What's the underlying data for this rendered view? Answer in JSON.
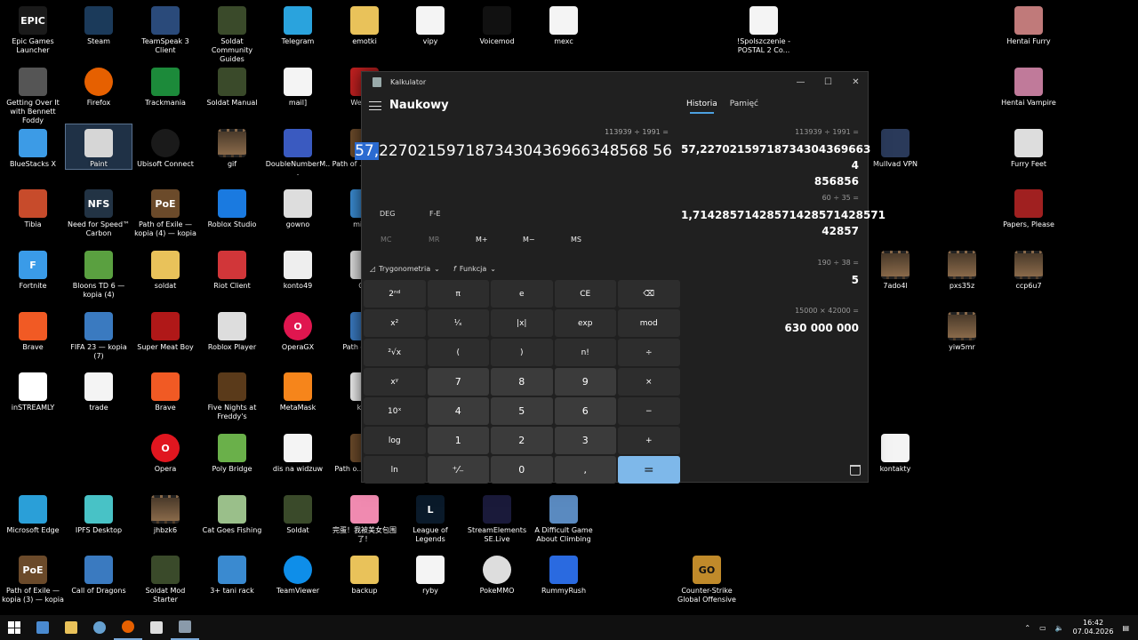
{
  "desktop_icons": [
    {
      "label": "Epic Games Launcher",
      "icon": "epic-games-icon",
      "color": "#1a1a1a",
      "text": "EPIC"
    },
    {
      "label": "Getting Over It with Bennett Foddy",
      "icon": "hammer-icon",
      "color": "#555555",
      "text": ""
    },
    {
      "label": "BlueStacks X",
      "icon": "bluestacks-icon",
      "color": "#3c9be6",
      "text": ""
    },
    {
      "label": "Tibia",
      "icon": "tibia-icon",
      "color": "#c74b2b",
      "text": ""
    },
    {
      "label": "Fortnite",
      "icon": "fortnite-icon",
      "color": "#3a9be8",
      "text": "F"
    },
    {
      "label": "Brave",
      "icon": "brave-icon",
      "color": "#f15a24",
      "text": ""
    },
    {
      "label": "inSTREAMLY",
      "icon": "instreamly-icon",
      "color": "#ffffff",
      "text": ""
    },
    {
      "label": "Microsoft Edge",
      "icon": "edge-icon",
      "color": "#2a9fd8",
      "text": ""
    },
    {
      "label": "Path of Exile — kopia (3) — kopia",
      "icon": "poe-icon",
      "color": "#6b4a2a",
      "text": "PoE"
    },
    {
      "label": "Steam",
      "icon": "steam-icon",
      "color": "#1b3a5a",
      "text": ""
    },
    {
      "label": "Firefox",
      "icon": "firefox-icon",
      "color": "#e66000",
      "text": ""
    },
    {
      "label": "Paint",
      "icon": "paint-icon",
      "color": "#d6d6d6",
      "text": ""
    },
    {
      "label": "Need for Speed™ Carbon",
      "icon": "nfs-icon",
      "color": "#223344",
      "text": "NFS"
    },
    {
      "label": "Bloons TD 6 — kopia (4)",
      "icon": "bloons-icon",
      "color": "#5aa040",
      "text": ""
    },
    {
      "label": "FIFA 23 — kopia (7)",
      "icon": "shortcut-icon",
      "color": "#3a7ac0",
      "text": ""
    },
    {
      "label": "trade",
      "icon": "file-icon",
      "color": "#f4f4f4",
      "text": ""
    },
    {
      "label": "",
      "icon": "",
      "color": "",
      "text": ""
    },
    {
      "label": "IPFS Desktop",
      "icon": "ipfs-icon",
      "color": "#48c2c6",
      "text": ""
    },
    {
      "label": "Call of Dragons",
      "icon": "shortcut-icon",
      "color": "#3a7ac0",
      "text": ""
    },
    {
      "label": "TeamSpeak 3 Client",
      "icon": "teamspeak-icon",
      "color": "#2a4a7a",
      "text": ""
    },
    {
      "label": "Trackmania",
      "icon": "trackmania-icon",
      "color": "#1c8a3a",
      "text": ""
    },
    {
      "label": "Ubisoft Connect",
      "icon": "ubisoft-icon",
      "color": "#1a1a1a",
      "text": ""
    },
    {
      "label": "Path of Exile — kopia (4) — kopia",
      "icon": "poe-icon",
      "color": "#6b4a2a",
      "text": "PoE"
    },
    {
      "label": "soldat",
      "icon": "folder-icon",
      "color": "#e9c25a",
      "text": ""
    },
    {
      "label": "Super Meat Boy",
      "icon": "meatboy-icon",
      "color": "#b01818",
      "text": ""
    },
    {
      "label": "Brave",
      "icon": "brave-icon",
      "color": "#f15a24",
      "text": ""
    },
    {
      "label": "Opera",
      "icon": "opera-icon",
      "color": "#e0161f",
      "text": "O"
    },
    {
      "label": "jhbzk6",
      "icon": "video-icon",
      "color": "#6a5a4a",
      "text": ""
    },
    {
      "label": "Soldat Mod Starter",
      "icon": "soldat-icon",
      "color": "#3a4a2a",
      "text": ""
    },
    {
      "label": "Soldat Community Guides",
      "icon": "soldat-icon",
      "color": "#3a4a2a",
      "text": ""
    },
    {
      "label": "Soldat Manual",
      "icon": "soldat-icon",
      "color": "#3a4a2a",
      "text": ""
    },
    {
      "label": "gif",
      "icon": "video-icon",
      "color": "#4a4a4a",
      "text": ""
    },
    {
      "label": "Roblox Studio",
      "icon": "roblox-studio-icon",
      "color": "#1a7ae0",
      "text": ""
    },
    {
      "label": "Riot Client",
      "icon": "riot-icon",
      "color": "#d13639",
      "text": ""
    },
    {
      "label": "Roblox Player",
      "icon": "roblox-icon",
      "color": "#dddddd",
      "text": ""
    },
    {
      "label": "Five Nights at Freddy's",
      "icon": "fnaf-icon",
      "color": "#5a3a1a",
      "text": ""
    },
    {
      "label": "Poly Bridge",
      "icon": "polybridge-icon",
      "color": "#6ab04a",
      "text": ""
    },
    {
      "label": "Cat Goes Fishing",
      "icon": "catfishing-icon",
      "color": "#9abf8a",
      "text": ""
    },
    {
      "label": "3+ tani rack",
      "icon": "keyboard-icon",
      "color": "#3a8ad0",
      "text": ""
    },
    {
      "label": "Telegram",
      "icon": "telegram-icon",
      "color": "#2aa3dd",
      "text": ""
    },
    {
      "label": "mail]",
      "icon": "file-icon",
      "color": "#f4f4f4",
      "text": ""
    },
    {
      "label": "DoubleNumberM...",
      "icon": "doublenumber-icon",
      "color": "#3a5ac0",
      "text": ""
    },
    {
      "label": "gowno",
      "icon": "gowno-icon",
      "color": "#dddddd",
      "text": ""
    },
    {
      "label": "konto49",
      "icon": "konto-icon",
      "color": "#eeeeee",
      "text": ""
    },
    {
      "label": "OperaGX",
      "icon": "operagx-icon",
      "color": "#e0164f",
      "text": "O"
    },
    {
      "label": "MetaMask",
      "icon": "metamask-icon",
      "color": "#f6851b",
      "text": ""
    },
    {
      "label": "dis na widzuw",
      "icon": "file-icon",
      "color": "#f4f4f4",
      "text": ""
    },
    {
      "label": "Soldat",
      "icon": "soldat-icon",
      "color": "#3a4a2a",
      "text": ""
    },
    {
      "label": "TeamViewer",
      "icon": "teamviewer-icon",
      "color": "#0e8ee9",
      "text": ""
    },
    {
      "label": "emotki",
      "icon": "folder-icon",
      "color": "#e9c25a",
      "text": ""
    },
    {
      "label": "Welco...",
      "icon": "welcome-icon",
      "color": "#c02020",
      "text": ""
    },
    {
      "label": "Path of ... kopia (5",
      "icon": "poe-icon",
      "color": "#6b4a2a",
      "text": ""
    },
    {
      "label": "mint...",
      "icon": "mint-icon",
      "color": "#3a8ad0",
      "text": ""
    },
    {
      "label": "O...",
      "icon": "o-icon",
      "color": "#dddddd",
      "text": ""
    },
    {
      "label": "Path o... kop",
      "icon": "shortcut-icon",
      "color": "#3a7ac0",
      "text": ""
    },
    {
      "label": "ko...",
      "icon": "konto-icon",
      "color": "#eeeeee",
      "text": ""
    },
    {
      "label": "Path o... kopia (6",
      "icon": "poe-icon",
      "color": "#6b4a2a",
      "text": ""
    },
    {
      "label": "完蛋！我被美女包围了！",
      "icon": "heart-game-icon",
      "color": "#f08ab0",
      "text": ""
    },
    {
      "label": "backup",
      "icon": "folder-icon",
      "color": "#e9c25a",
      "text": ""
    },
    {
      "label": "vipy",
      "icon": "file-icon",
      "color": "#f4f4f4",
      "text": ""
    },
    {
      "label": "League of Legends",
      "icon": "lol-icon",
      "color": "#0a1a2a",
      "text": "L"
    },
    {
      "label": "ryby",
      "icon": "file-icon",
      "color": "#f4f4f4",
      "text": ""
    },
    {
      "label": "Voicemod",
      "icon": "voicemod-icon",
      "color": "#111111",
      "text": ""
    },
    {
      "label": "StreamElements SE.Live",
      "icon": "streamelements-icon",
      "color": "#1a1a3a",
      "text": ""
    },
    {
      "label": "PokeMMO",
      "icon": "pokemmo-icon",
      "color": "#dddddd",
      "text": ""
    },
    {
      "label": "mexc",
      "icon": "file-icon",
      "color": "#f4f4f4",
      "text": ""
    },
    {
      "label": "A Difficult Game About Climbing",
      "icon": "climbing-icon",
      "color": "#5a8ac0",
      "text": ""
    },
    {
      "label": "RummyRush",
      "icon": "rummy-icon",
      "color": "#2a6ae0",
      "text": ""
    },
    {
      "label": "Counter-Strike Global Offensive",
      "icon": "csgo-icon",
      "color": "#c08a2a",
      "text": "GO"
    },
    {
      "label": "!Spolszczenie - POSTAL 2 Co...",
      "icon": "file-icon",
      "color": "#f4f4f4",
      "text": ""
    },
    {
      "label": "Mullvad VPN",
      "icon": "mullvad-icon",
      "color": "#2a3a5a",
      "text": ""
    },
    {
      "label": "kontakty",
      "icon": "file-icon",
      "color": "#f4f4f4",
      "text": ""
    },
    {
      "label": "7ado4l",
      "icon": "video-icon",
      "color": "#6a5a4a",
      "text": ""
    },
    {
      "label": "pxs35z",
      "icon": "video-icon",
      "color": "#6a5a4a",
      "text": ""
    },
    {
      "label": "yiw5mr",
      "icon": "video-icon",
      "color": "#6a5a4a",
      "text": ""
    },
    {
      "label": "ccp6u7",
      "icon": "video-icon",
      "color": "#6a5a4a",
      "text": ""
    },
    {
      "label": "Hentai Furry",
      "icon": "anime-icon",
      "color": "#c07a7a",
      "text": ""
    },
    {
      "label": "Hentai Vampire",
      "icon": "anime-icon",
      "color": "#c07a9a",
      "text": ""
    },
    {
      "label": "Furry Feet",
      "icon": "anime-icon",
      "color": "#dddddd",
      "text": ""
    },
    {
      "label": "Papers, Please",
      "icon": "papers-please-icon",
      "color": "#a02020",
      "text": ""
    }
  ],
  "calculator": {
    "window_title": "Kalkulator",
    "mode": "Naukowy",
    "expression": "113939 ÷ 1991 =",
    "display_highlight": "57,",
    "display_rest": "2270215971873430436966348568 56",
    "angle_mode": "DEG",
    "fe_label": "F-E",
    "memory": [
      "MC",
      "MR",
      "M+",
      "M−",
      "MS"
    ],
    "trig_label": "Trygonometria",
    "func_label": "Funkcja",
    "keys": [
      "2ⁿᵈ",
      "π",
      "e",
      "CE",
      "⌫",
      "x²",
      "¹⁄ₓ",
      "|x|",
      "exp",
      "mod",
      "²√x",
      "(",
      ")",
      "n!",
      "÷",
      "xʸ",
      "7",
      "8",
      "9",
      "×",
      "10ˣ",
      "4",
      "5",
      "6",
      "−",
      "log",
      "1",
      "2",
      "3",
      "+",
      "ln",
      "⁺⁄₋",
      "0",
      ",",
      "="
    ],
    "tabs": [
      "Historia",
      "Pamięć"
    ],
    "history": [
      {
        "expr": "113939  ÷  1991 =",
        "result_line1": "57,22702159718734304369663 4",
        "result_line2": "856856"
      },
      {
        "expr": "60  ÷  35 =",
        "result_line1": "1,71428571428571428571428571",
        "result_line2": "42857"
      },
      {
        "expr": "190  ÷  38 =",
        "result_line1": "5",
        "result_line2": ""
      },
      {
        "expr": "15000  ×  42000 =",
        "result_line1": "630 000 000",
        "result_line2": ""
      }
    ]
  },
  "taskbar": {
    "time": "16:42",
    "date": "07.04.2026",
    "apps": [
      {
        "icon": "start-icon",
        "color": "#ffffff"
      },
      {
        "icon": "explorer-window-icon",
        "color": "#4a8ad0"
      },
      {
        "icon": "file-explorer-icon",
        "color": "#e9c25a"
      },
      {
        "icon": "steam-icon",
        "color": "#66a0d0"
      },
      {
        "icon": "firefox-icon",
        "color": "#e66000"
      },
      {
        "icon": "settings-icon",
        "color": "#dddddd"
      },
      {
        "icon": "calculator-icon",
        "color": "#8a9aaa"
      }
    ]
  }
}
